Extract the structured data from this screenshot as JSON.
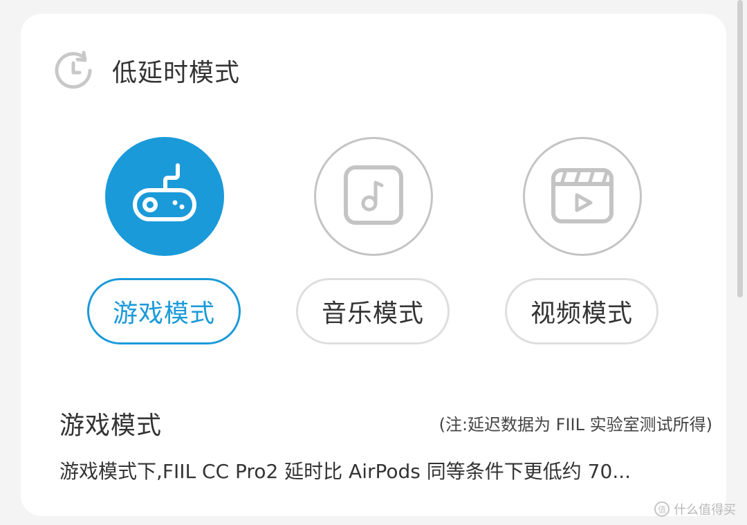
{
  "header": {
    "title": "低延时模式",
    "icon": "clock-refresh-icon"
  },
  "modes": [
    {
      "label": "游戏模式",
      "icon": "gamepad-icon",
      "active": true
    },
    {
      "label": "音乐模式",
      "icon": "music-note-icon",
      "active": false
    },
    {
      "label": "视频模式",
      "icon": "clapperboard-icon",
      "active": false
    }
  ],
  "description": {
    "title": "游戏模式",
    "note": "(注:延迟数据为 FIIL 实验室测试所得)",
    "text": "游戏模式下,FIIL CC Pro2 延时比 AirPods 同等条件下更低约 70..."
  },
  "watermark": {
    "badge": "值",
    "text": "什么值得买"
  },
  "colors": {
    "accent": "#1a9ad9",
    "inactive_border": "#c4c4c4",
    "text": "#333333",
    "background": "#f4f4f4"
  }
}
